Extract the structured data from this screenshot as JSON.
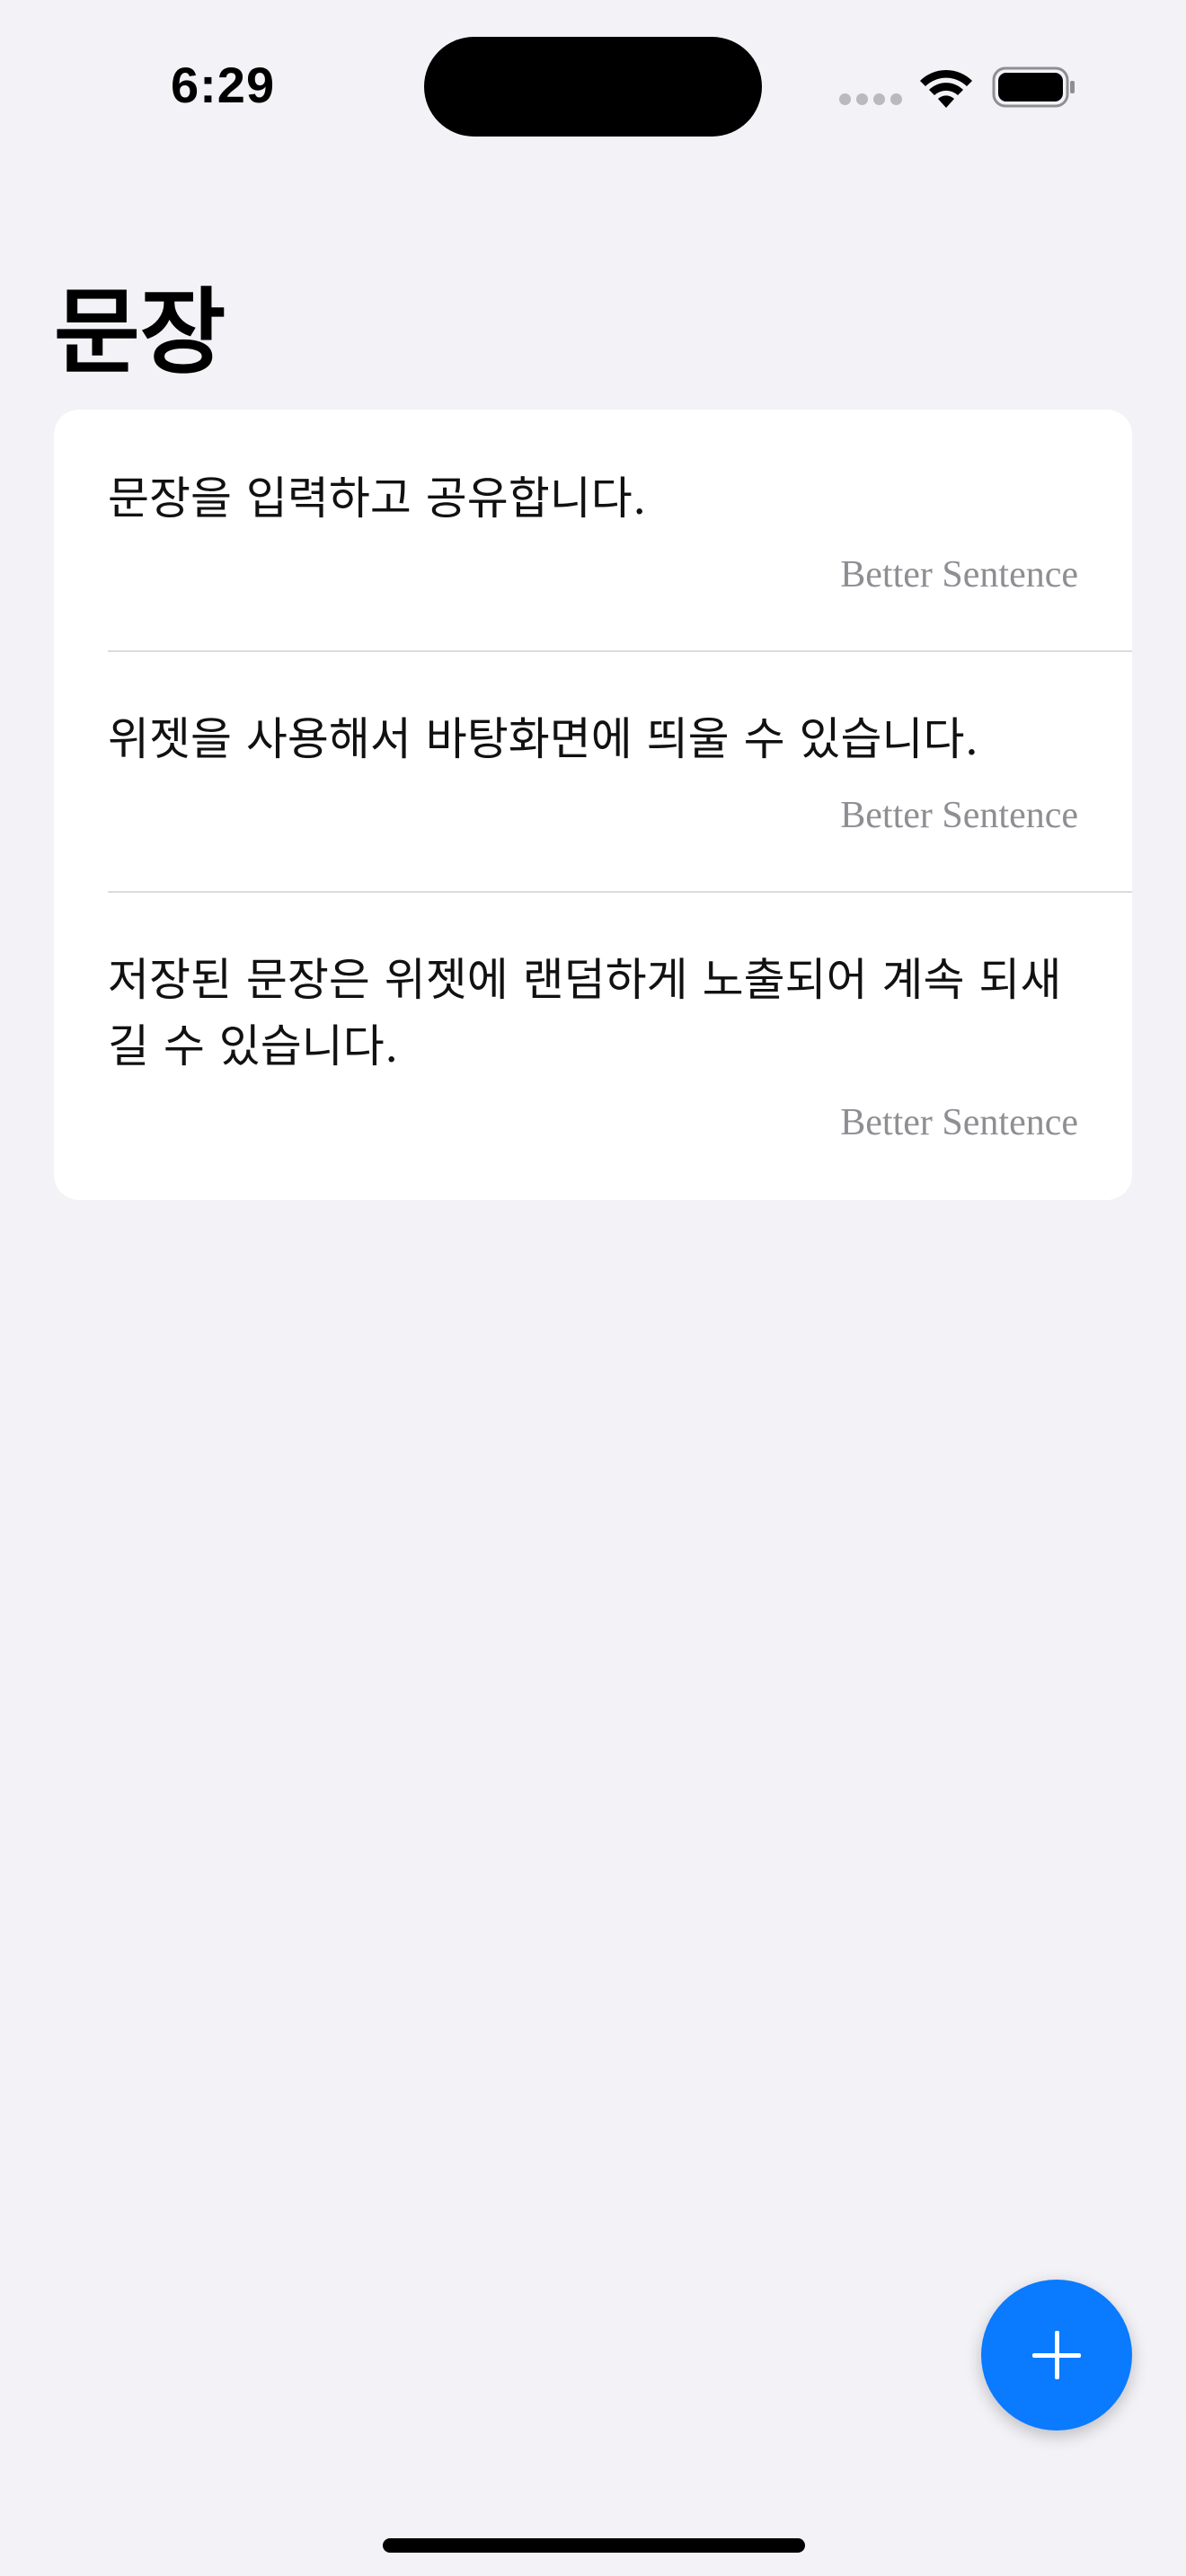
{
  "status_bar": {
    "time": "6:29",
    "icons": [
      "cellular-signal-icon",
      "wifi-icon",
      "battery-icon"
    ]
  },
  "header": {
    "title": "문장"
  },
  "sentences": [
    {
      "text": "문장을 입력하고 공유합니다.",
      "source": "Better Sentence"
    },
    {
      "text": "위젯을 사용해서 바탕화면에 띄울 수 있습니다.",
      "source": "Better Sentence"
    },
    {
      "text": "저장된 문장은 위젯에 랜덤하게 노출되어 계속 되새길 수 있습니다.",
      "source": "Better Sentence"
    }
  ],
  "fab": {
    "icon": "plus-icon",
    "color": "#0a7aff"
  },
  "colors": {
    "background": "#f2f2f7",
    "card": "#ffffff",
    "secondary_text": "#8e8e93",
    "accent": "#0a7aff"
  }
}
